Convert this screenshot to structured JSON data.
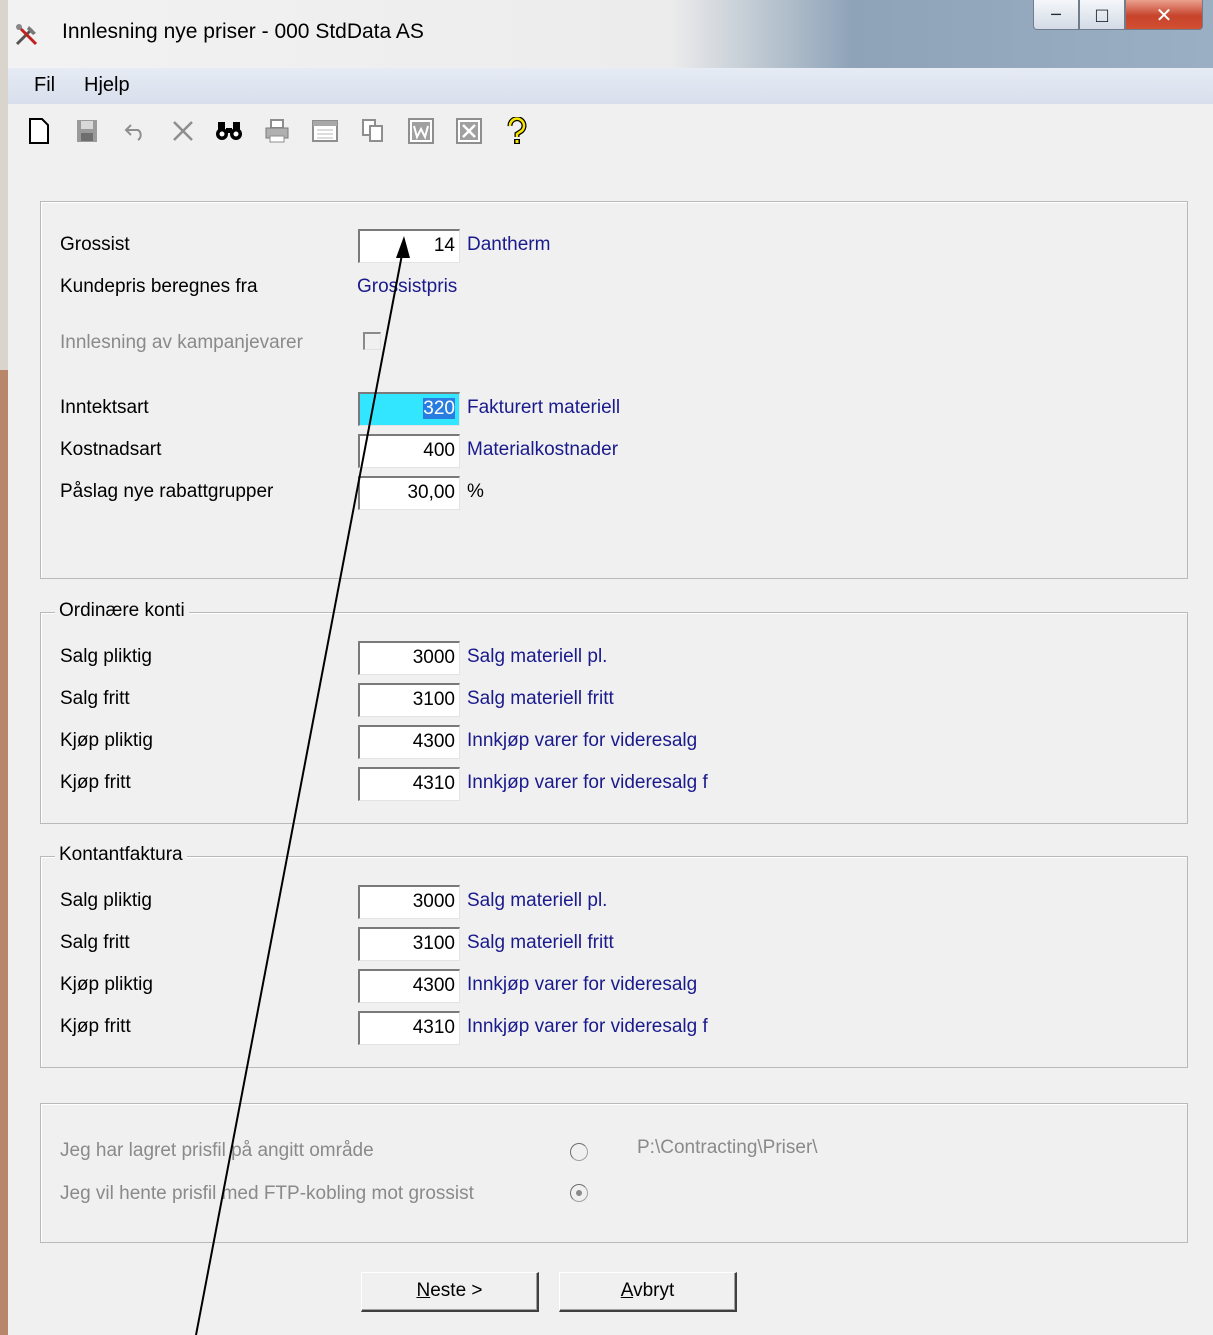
{
  "window": {
    "title": "Innlesning nye priser - 000 StdData AS"
  },
  "menu": {
    "items": [
      "Fil",
      "Hjelp"
    ]
  },
  "toolbar": {
    "icons": [
      "new-document-icon",
      "save-icon",
      "undo-icon",
      "delete-icon",
      "find-icon",
      "print-icon",
      "form-icon",
      "copy-icon",
      "word-icon",
      "excel-icon",
      "help-icon"
    ]
  },
  "main": {
    "grossist": {
      "label": "Grossist",
      "value": "14",
      "desc": "Dantherm"
    },
    "kundepris": {
      "label": "Kundepris beregnes fra",
      "value": "Grossistpris"
    },
    "kampanje": {
      "label": "Innlesning av kampanjevarer",
      "checked": false
    },
    "inntektsart": {
      "label": "Inntektsart",
      "value": "320",
      "desc": "Fakturert materiell"
    },
    "kostnadsart": {
      "label": "Kostnadsart",
      "value": "400",
      "desc": "Materialkostnader"
    },
    "paslag": {
      "label": "Påslag nye rabattgrupper",
      "value": "30,00",
      "unit": "%"
    }
  },
  "ordinare": {
    "title": "Ordinære konti",
    "rows": [
      {
        "label": "Salg pliktig",
        "value": "3000",
        "desc": "Salg materiell pl."
      },
      {
        "label": "Salg fritt",
        "value": "3100",
        "desc": "Salg materiell fritt"
      },
      {
        "label": "Kjøp pliktig",
        "value": "4300",
        "desc": "Innkjøp varer for videresalg"
      },
      {
        "label": "Kjøp fritt",
        "value": "4310",
        "desc": "Innkjøp varer for videresalg f"
      }
    ]
  },
  "kontant": {
    "title": "Kontantfaktura",
    "rows": [
      {
        "label": "Salg pliktig",
        "value": "3000",
        "desc": "Salg materiell pl."
      },
      {
        "label": "Salg fritt",
        "value": "3100",
        "desc": "Salg materiell fritt"
      },
      {
        "label": "Kjøp pliktig",
        "value": "4300",
        "desc": "Innkjøp varer for videresalg"
      },
      {
        "label": "Kjøp fritt",
        "value": "4310",
        "desc": "Innkjøp varer for videresalg f"
      }
    ]
  },
  "source": {
    "option1": {
      "label": "Jeg har lagret prisfil på angitt område",
      "path": "P:\\Contracting\\Priser\\",
      "selected": false
    },
    "option2": {
      "label": "Jeg vil hente prisfil med FTP-kobling mot grossist",
      "selected": true
    }
  },
  "buttons": {
    "next": {
      "mnemonic": "N",
      "rest": "este >"
    },
    "cancel": {
      "mnemonic": "A",
      "rest": "vbryt"
    }
  }
}
